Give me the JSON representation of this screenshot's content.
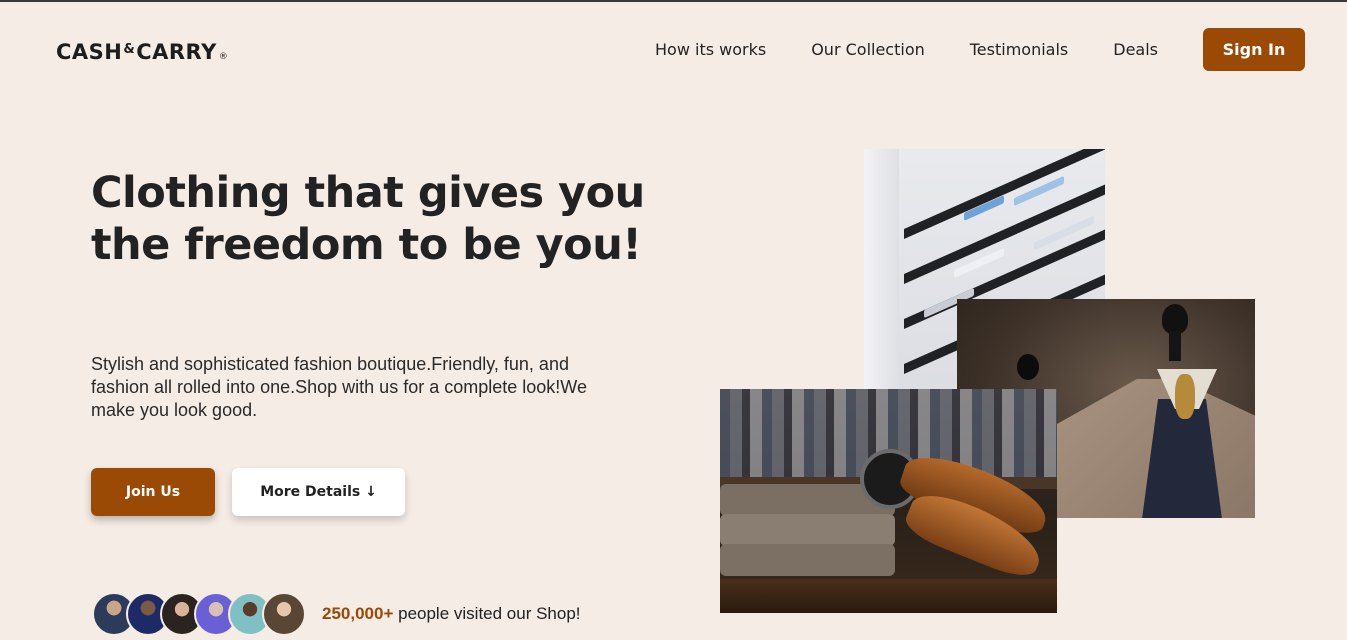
{
  "brand": {
    "name_part1": "CASH",
    "amp": "&",
    "name_part2": "CARRY",
    "reg": "®"
  },
  "nav": {
    "links": [
      "How its works",
      "Our Collection",
      "Testimonials",
      "Deals"
    ],
    "signin_label": "Sign In"
  },
  "hero": {
    "title": "Clothing that gives you the freedom to be you!",
    "description": "Stylish and sophisticated fashion boutique.Friendly, fun, and fashion all rolled into one.Shop with us for a complete look!We make you look good.",
    "join_label": "Join Us",
    "more_label": "More Details ↓"
  },
  "visitors": {
    "count": "250,000+",
    "text": " people visited our Shop!"
  },
  "colors": {
    "accent": "#9b4a06",
    "background": "#f6ece6"
  }
}
